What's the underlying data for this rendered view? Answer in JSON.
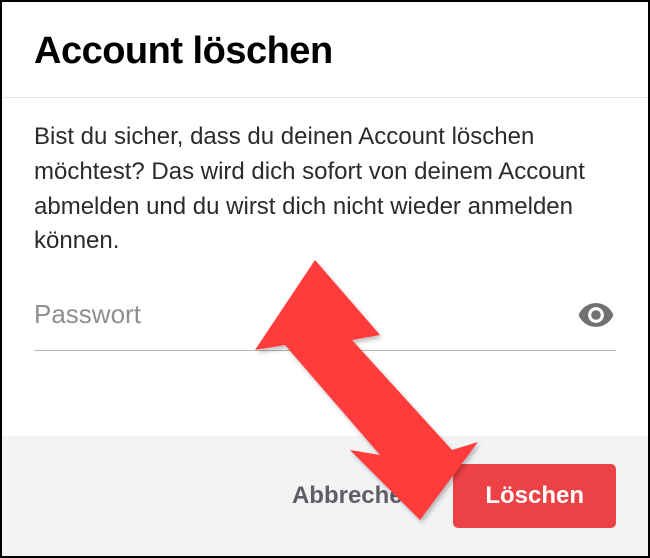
{
  "dialog": {
    "title": "Account löschen",
    "message": "Bist du sicher, dass du deinen Account löschen möchtest? Das wird dich sofort von deinem Account abmelden und du wirst dich nicht wieder anmelden können.",
    "password_placeholder": "Passwort",
    "cancel_label": "Abbrechen",
    "delete_label": "Löschen"
  },
  "colors": {
    "danger": "#ed4245",
    "footer_bg": "#f2f3f5",
    "annotation_arrow": "#ff3a3a"
  }
}
